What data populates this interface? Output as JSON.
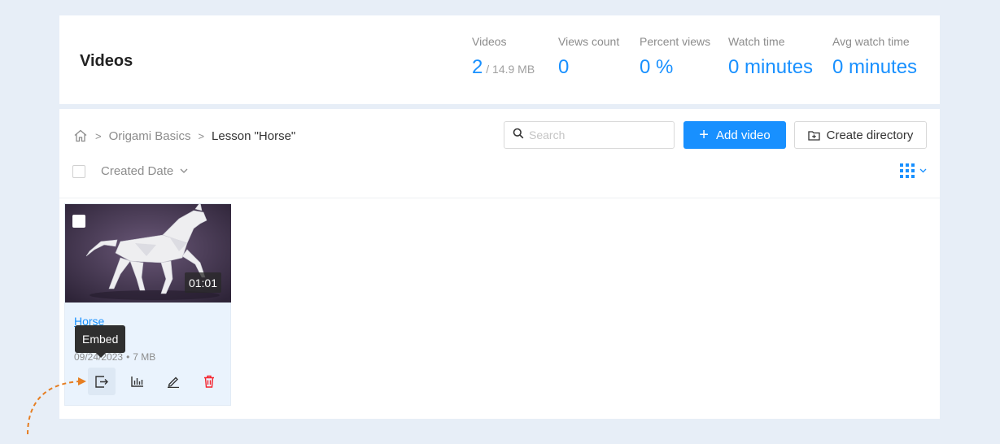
{
  "header": {
    "title": "Videos",
    "stats": [
      {
        "label": "Videos",
        "value": "2",
        "sub": " / 14.9 MB"
      },
      {
        "label": "Views count",
        "value": "0",
        "sub": ""
      },
      {
        "label": "Percent views",
        "value": "0 %",
        "sub": ""
      },
      {
        "label": "Watch time",
        "value": "0 minutes",
        "sub": ""
      },
      {
        "label": "Avg watch time",
        "value": "0 minutes",
        "sub": ""
      }
    ]
  },
  "breadcrumb": {
    "items": [
      "Origami Basics",
      "Lesson \"Horse\""
    ],
    "separator": ">"
  },
  "toolbar": {
    "search_placeholder": "Search",
    "add_video_label": "Add video",
    "create_directory_label": "Create directory",
    "sort_label": "Created Date"
  },
  "videos": [
    {
      "title": "Horse",
      "duration": "01:01",
      "date": "09/24/2023",
      "size": "7 MB"
    }
  ],
  "tooltip": {
    "text": "Embed"
  },
  "colors": {
    "accent": "#1890ff",
    "background": "#e7eef7",
    "delete": "#f5222d",
    "annotation_arrow": "#e67e22"
  },
  "icons": {
    "home": "home-icon",
    "search": "search-icon",
    "add": "plus-icon",
    "folder": "folder-plus-icon",
    "grid": "grid-icon",
    "embed": "embed-icon",
    "stats": "bar-chart-icon",
    "edit": "pencil-icon",
    "delete": "trash-icon"
  }
}
